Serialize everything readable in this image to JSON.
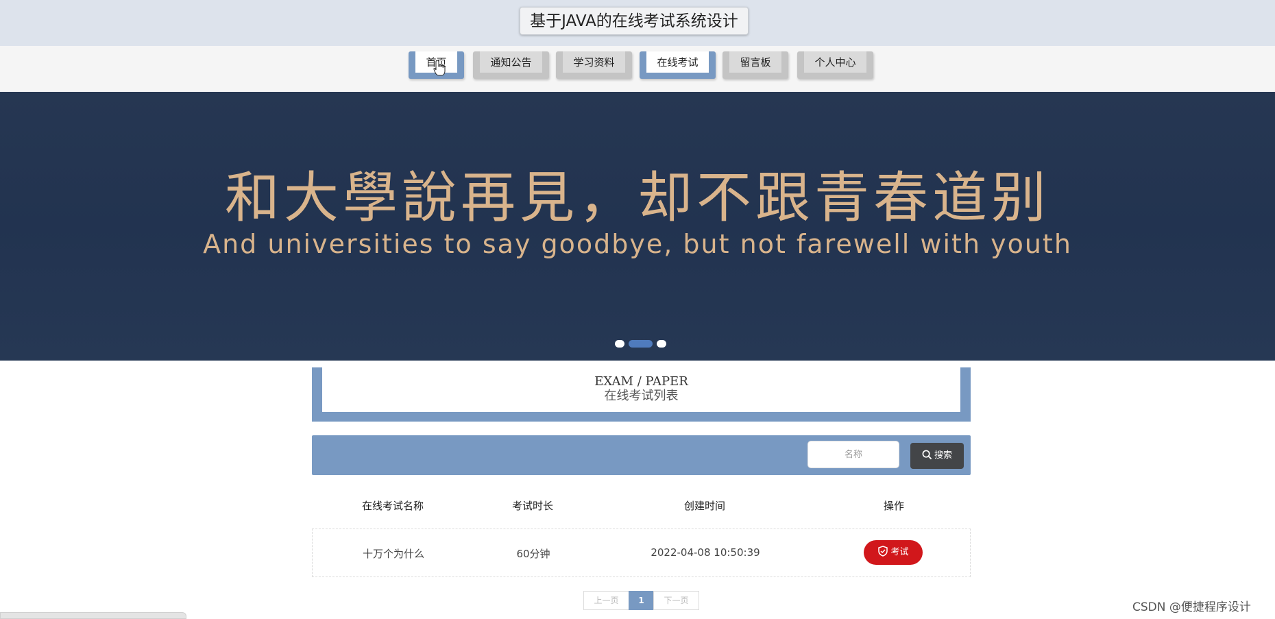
{
  "header": {
    "title": "基于JAVA的在线考试系统设计"
  },
  "nav": {
    "items": [
      {
        "label": "首页",
        "active": true
      },
      {
        "label": "通知公告",
        "active": false
      },
      {
        "label": "学习资料",
        "active": false
      },
      {
        "label": "在线考试",
        "active": true
      },
      {
        "label": "留言板",
        "active": false
      },
      {
        "label": "个人中心",
        "active": false
      }
    ]
  },
  "banner": {
    "headline": "和大學說再見，却不跟青春道别",
    "subline": "And universities to say goodbye, but not farewell with youth",
    "slides": 3,
    "active_slide": 2
  },
  "section": {
    "title_en": "EXAM / PAPER",
    "title_cn": "在线考试列表"
  },
  "search": {
    "placeholder": "名称",
    "button_label": "搜索"
  },
  "table": {
    "headers": [
      "在线考试名称",
      "考试时长",
      "创建时间",
      "操作"
    ],
    "rows": [
      {
        "name": "十万个为什么",
        "duration": "60分钟",
        "created": "2022-04-08 10:50:39",
        "action": "考试"
      }
    ]
  },
  "pagination": {
    "prev": "上一页",
    "current": "1",
    "next": "下一页"
  },
  "watermark": "CSDN @便捷程序设计",
  "colors": {
    "accent": "#7899c2",
    "banner_bg": "#233452",
    "banner_text": "#d9b48c",
    "exam_button": "#d1171b",
    "search_button": "#434548"
  },
  "icons": {
    "search": "search-icon",
    "exam": "shield-check-icon",
    "cursor": "hand-pointer-icon"
  }
}
